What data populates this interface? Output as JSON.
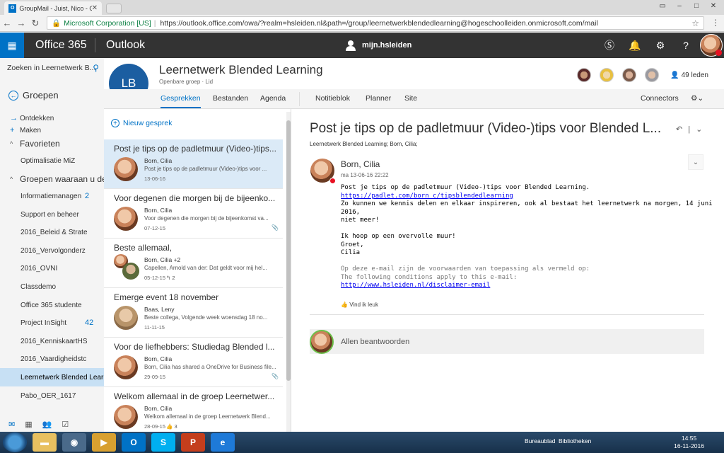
{
  "browser": {
    "tab_title": "GroupMail - Juist, Nico - Outl",
    "secure_label": "Microsoft Corporation [US]",
    "url": "https://outlook.office.com/owa/?realm=hsleiden.nl&path=/group/leernetwerkblendedlearning@hogeschoolleiden.onmicrosoft.com/mail"
  },
  "header": {
    "brand": "Office 365",
    "app": "Outlook",
    "user": "mijn.hsleiden"
  },
  "leftnav": {
    "search_placeholder": "Zoeken in Leernetwerk B...",
    "groups_label": "Groepen",
    "discover": "Ontdekken",
    "create": "Maken",
    "favorites": "Favorieten",
    "fav_items": [
      "Optimalisatie MiZ"
    ],
    "member_groups_label": "Groepen waaraan u de",
    "groups": [
      {
        "name": "Informatiemanagen",
        "count": "2"
      },
      {
        "name": "Support en beheer",
        "count": ""
      },
      {
        "name": "2016_Beleid & Strate",
        "count": ""
      },
      {
        "name": "2016_Vervolgonderz",
        "count": ""
      },
      {
        "name": "2016_OVNI",
        "count": ""
      },
      {
        "name": "Classdemo",
        "count": ""
      },
      {
        "name": "Office 365 studente",
        "count": ""
      },
      {
        "name": "Project InSight",
        "count": "42"
      },
      {
        "name": "2016_KenniskaartHS",
        "count": ""
      },
      {
        "name": "2016_Vaardigheidstc",
        "count": ""
      },
      {
        "name": "Leernetwerk Blended Lear",
        "count": ""
      },
      {
        "name": "Pabo_OER_1617",
        "count": ""
      }
    ]
  },
  "group": {
    "initials": "LB",
    "name": "Leernetwerk Blended Learning",
    "type": "Openbare groep",
    "role": "Lid",
    "members": "49 leden",
    "tabs": [
      "Gesprekken",
      "Bestanden",
      "Agenda",
      "Notitieblok",
      "Planner",
      "Site"
    ],
    "connectors": "Connectors"
  },
  "conversations": {
    "new_label": "Nieuw gesprek",
    "items": [
      {
        "subject": "Post je tips op de padletmuur (Video-)tips...",
        "from": "Born, Cilia",
        "preview": "Post je tips op de padletmuur (Video-)tips voor ...",
        "date": "13-06-16",
        "meta": ""
      },
      {
        "subject": "Voor degenen die morgen bij de bijeenko...",
        "from": "Born, Cilia",
        "preview": "Voor degenen die morgen bij de bijeenkomst va...",
        "date": "07-12-15",
        "meta": ""
      },
      {
        "subject": "Beste allemaal,",
        "from": "Born, Cilia +2",
        "preview": "Capellen, Arnold van der: Dat geldt voor mij hel...",
        "date": "05-12-15",
        "meta": "2"
      },
      {
        "subject": "Emerge event 18 november",
        "from": "Baas, Leny",
        "preview": "Beste collega,   Volgende week woensdag 18 no...",
        "date": "11-11-15",
        "meta": ""
      },
      {
        "subject": "Voor de liefhebbers: Studiedag Blended l...",
        "from": "Born, Cilia",
        "preview": "Born, Cilia has shared a OneDrive for Business file...",
        "date": "29-09-15",
        "meta": ""
      },
      {
        "subject": "Welkom allemaal in de groep Leernetwer...",
        "from": "Born, Cilia",
        "preview": "Welkom allemaal in de groep Leernetwerk Blend...",
        "date": "28-09-15",
        "meta": "3"
      }
    ]
  },
  "message": {
    "subject": "Post je tips op de padletmuur (Video-)tips voor Blended L...",
    "to": "Leernetwerk Blended Learning; Born, Cilia;",
    "from": "Born, Cilia",
    "date": "ma 13-06-16 22:22",
    "line1": "Post je tips op de padletmuur (Video-)tips voor Blended Learning.",
    "link1": "https://padlet.com/born_c/tipsblendedlearning",
    "line2": "Zo kunnen we kennis delen en elkaar inspireren, ook al bestaat het leernetwerk na morgen, 14 juni 2016,",
    "line3": "niet meer!",
    "line4": "Ik hoop op een overvolle muur!",
    "line5": "Groet,",
    "line6": "Cilia",
    "disc1": "Op deze e-mail zijn de voorwaarden van toepassing als vermeld op:",
    "disc2": "The following conditions apply to this e-mail:",
    "link2": "http://www.hsleiden.nl/disclaimer-email",
    "like": "Vind ik leuk",
    "reply": "Allen beantwoorden"
  },
  "taskbar": {
    "desktop": "Bureaublad",
    "libraries": "Bibliotheken",
    "time": "14:55",
    "date": "16-11-2016"
  },
  "colors": {
    "accent": "#0072c6",
    "header": "#333333",
    "group_badge": "#1b5ea1"
  }
}
